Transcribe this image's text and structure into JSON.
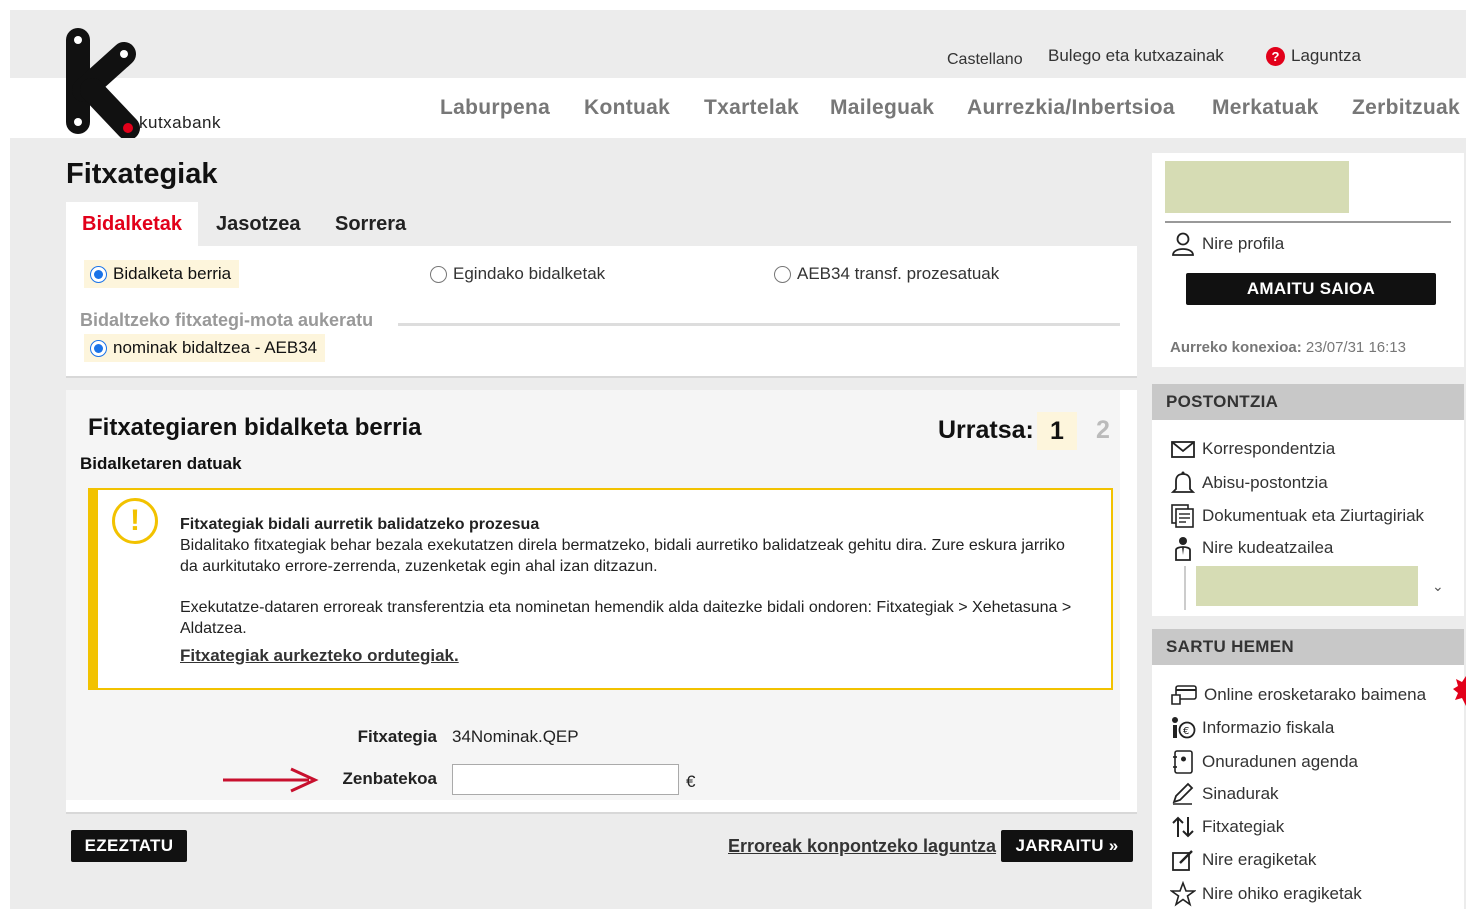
{
  "header": {
    "brand": "kutxabank",
    "lang_link": "Castellano",
    "offices_link": "Bulego eta kutxazainak",
    "help_link": "Laguntza"
  },
  "nav": [
    "Laburpena",
    "Kontuak",
    "Txartelak",
    "Maileguak",
    "Aurrezkia/Inbertsioa",
    "Merkatuak",
    "Zerbitzuak"
  ],
  "page": {
    "title": "Fitxategiak",
    "tabs": [
      "Bidalketak",
      "Jasotzea",
      "Sorrera"
    ]
  },
  "options": {
    "send_modes": [
      "Bidalketa berria",
      "Egindako bidalketak",
      "AEB34 transf. prozesatuak"
    ],
    "type_label": "Bidaltzeko fitxategi-mota aukeratu",
    "type_option": "nominak bidaltzea - AEB34"
  },
  "form": {
    "title": "Fitxategiaren bidalketa berria",
    "subtitle": "Bidalketaren datuak",
    "step_label": "Urratsa:",
    "step_current": "1",
    "step_next": "2",
    "warning": {
      "title": "Fitxategiak bidali aurretik balidatzeko prozesua",
      "text1": "Bidalitako fitxategiak behar bezala exekutatzen direla bermatzeko, bidali aurretiko balidatzeak gehitu dira. Zure eskura jarriko da aurkitutako errore-zerrenda, zuzenketak egin ahal izan ditzazun.",
      "text2": "Exekutatze-dataren erroreak transferentzia eta nominetan hemendik alda daitezke bidali ondoren: Fitxategiak > Xehetasuna > Aldatzea.",
      "link": "Fitxategiak aurkezteko ordutegiak."
    },
    "file_label": "Fitxategia",
    "file_value": "34Nominak.QEP",
    "amount_label": "Zenbatekoa",
    "amount_value": "",
    "currency": "€"
  },
  "actions": {
    "cancel": "EZEZTATU",
    "help": "Erroreak konpontzeko laguntza",
    "continue": "JARRAITU »"
  },
  "sidebar": {
    "profile": "Nire profila",
    "logout": "AMAITU SAIOA",
    "last_conn_label": "Aurreko konexioa:",
    "last_conn_value": "23/07/31 16:13",
    "mailbox_title": "POSTONTZIA",
    "mailbox_items": [
      "Korrespondentzia",
      "Abisu-postontzia",
      "Dokumentuak eta Ziurtagiriak",
      "Nire kudeatzailea"
    ],
    "enter_title": "SARTU HEMEN",
    "enter_items": [
      "Online erosketarako baimena",
      "Informazio fiskala",
      "Onuradunen agenda",
      "Sinadurak",
      "Fitxategiak",
      "Nire eragiketak",
      "Nire ohiko eragiketak"
    ]
  },
  "colors": {
    "accent_red": "#e2001a",
    "warning_yellow": "#f2c200",
    "highlight": "#fdf5dc",
    "redacted": "#d6dcb4"
  }
}
